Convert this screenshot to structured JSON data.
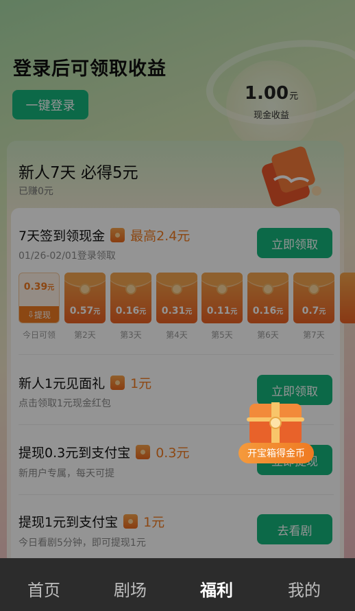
{
  "header": {
    "title": "登录后可领取收益",
    "login_button": "一键登录",
    "cash_value": "1.00",
    "cash_unit": "元",
    "cash_label": "现金收益"
  },
  "newbie": {
    "title": "新人7天 必得5元",
    "subtitle": "已赚0元"
  },
  "sign_in": {
    "title": "7天签到领现金",
    "highlight": "最高2.4元",
    "subtitle": "01/26-02/01登录领取",
    "button": "立即领取",
    "days": [
      {
        "amount": "0.39",
        "unit": "元",
        "label": "今日可领",
        "action": "提现"
      },
      {
        "amount": "0.57",
        "unit": "元",
        "label": "第2天"
      },
      {
        "amount": "0.16",
        "unit": "元",
        "label": "第3天"
      },
      {
        "amount": "0.31",
        "unit": "元",
        "label": "第4天"
      },
      {
        "amount": "0.11",
        "unit": "元",
        "label": "第5天"
      },
      {
        "amount": "0.16",
        "unit": "元",
        "label": "第6天"
      },
      {
        "amount": "0.7",
        "unit": "元",
        "label": "第7天"
      }
    ]
  },
  "tasks": [
    {
      "title": "新人1元见面礼",
      "reward": "1元",
      "subtitle": "点击领取1元现金红包",
      "button": "立即领取"
    },
    {
      "title": "提现0.3元到支付宝",
      "reward": "0.3元",
      "subtitle": "新用户专属，每天可提",
      "button": "立即提现"
    },
    {
      "title": "提现1元到支付宝",
      "reward": "1元",
      "subtitle": "今日看剧5分钟，即可提现1元",
      "button": "去看剧"
    }
  ],
  "treasure": {
    "label": "开宝箱得金币"
  },
  "tabbar": {
    "items": [
      "首页",
      "剧场",
      "福利",
      "我的"
    ],
    "active": "福利"
  },
  "colors": {
    "accent_green": "#15b57d",
    "reward_orange": "#f27c22"
  }
}
